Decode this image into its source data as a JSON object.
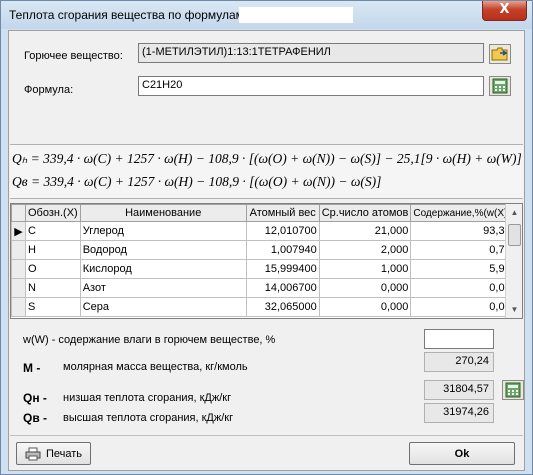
{
  "window": {
    "title": "Теплота сгорания вещества по формулам",
    "close_glyph": "X"
  },
  "substance": {
    "label": "Горючее вещество:",
    "value": "(1-МЕТИЛЭТИЛ)1:13:1ТЕТРАФЕНИЛ"
  },
  "formula": {
    "label": "Формула:",
    "value": "C21H20"
  },
  "equations": {
    "qh": "Qₕ = 339,4 · ω(C) + 1257 · ω(H) − 108,9 · [(ω(O) + ω(N)) − ω(S)] − 25,1[9 · ω(H) + ω(W)]",
    "qb": "Qв = 339,4 · ω(C) + 1257 · ω(H) − 108,9 · [(ω(O) + ω(N)) − ω(S)]"
  },
  "grid": {
    "columns": [
      "Обозн.(X)",
      "Наименование",
      "Атомный вес",
      "Ср.число атомов",
      "Содержание,%(w(X))"
    ],
    "rows": [
      {
        "sym": "C",
        "name": "Углерод",
        "weight": "12,010700",
        "atoms": "21,000",
        "content": "93,33",
        "current": true
      },
      {
        "sym": "H",
        "name": "Водород",
        "weight": "1,007940",
        "atoms": "2,000",
        "content": "0,75",
        "current": false
      },
      {
        "sym": "O",
        "name": "Кислород",
        "weight": "15,999400",
        "atoms": "1,000",
        "content": "5,92",
        "current": false
      },
      {
        "sym": "N",
        "name": "Азот",
        "weight": "14,006700",
        "atoms": "0,000",
        "content": "0,00",
        "current": false
      },
      {
        "sym": "S",
        "name": "Сера",
        "weight": "32,065000",
        "atoms": "0,000",
        "content": "0,00",
        "current": false
      }
    ]
  },
  "results": {
    "moisture_label": "w(W) - содержание влаги в горючем веществе, %",
    "moisture_value": "",
    "molar_sym": "M -",
    "molar_label": "молярная масса вещества, кг/кмоль",
    "molar_value": "270,24",
    "qh_sym": "Qн -",
    "qh_label": "низшая теплота сгорания, кДж/кг",
    "qh_value": "31804,57",
    "qb_sym": "Qв -",
    "qb_label": "высшая теплота сгорания, кДж/кг",
    "qb_value": "31974,26"
  },
  "buttons": {
    "print": "Печать",
    "ok": "Ok"
  },
  "icons": {
    "browse": "folder-browse-icon",
    "calc": "calculator-icon",
    "printer": "printer-icon"
  }
}
